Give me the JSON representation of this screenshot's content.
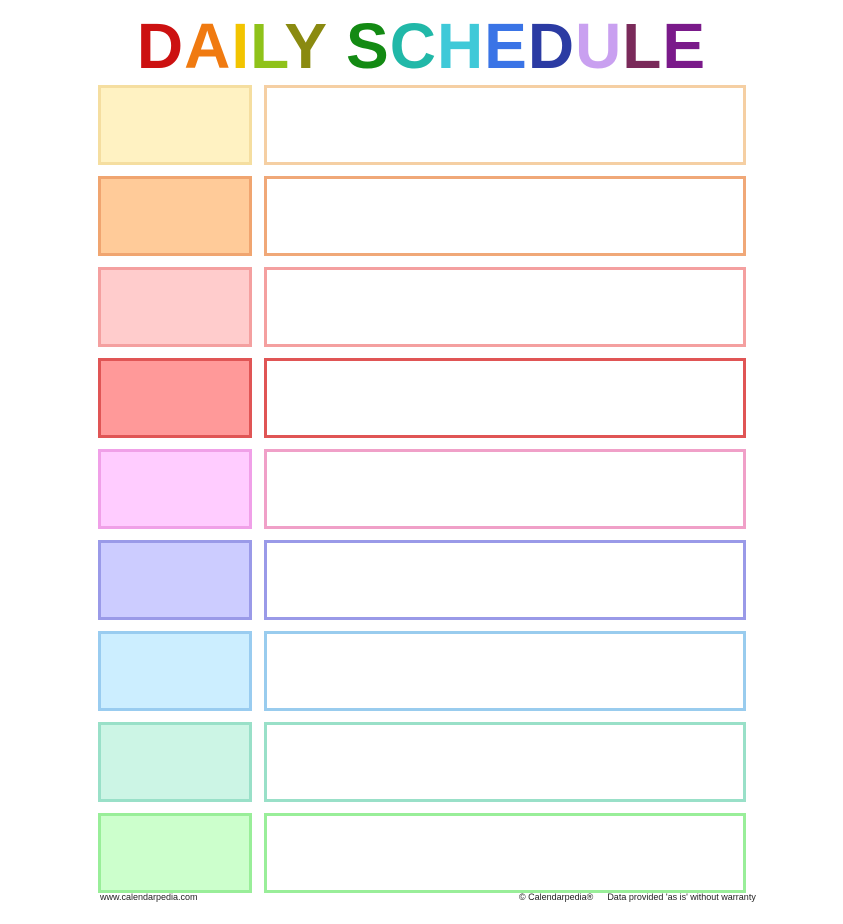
{
  "title": {
    "letters": [
      {
        "char": "D",
        "color": "#cc1111"
      },
      {
        "char": "A",
        "color": "#f07a10"
      },
      {
        "char": "I",
        "color": "#f2c400"
      },
      {
        "char": "L",
        "color": "#8fc21a"
      },
      {
        "char": "Y",
        "color": "#8a8a10"
      },
      {
        "char": " ",
        "color": "#ffffff"
      },
      {
        "char": "S",
        "color": "#138a13"
      },
      {
        "char": "C",
        "color": "#21b8a8"
      },
      {
        "char": "H",
        "color": "#3fc9d8"
      },
      {
        "char": "E",
        "color": "#3a74e6"
      },
      {
        "char": "D",
        "color": "#2b3ba3"
      },
      {
        "char": "U",
        "color": "#c9a0f0"
      },
      {
        "char": "L",
        "color": "#7a2a5a"
      },
      {
        "char": "E",
        "color": "#7a1a8a"
      }
    ]
  },
  "rows": [
    {
      "fill": "#fff2c2",
      "border": "#f5dea0",
      "task_border": "#f5cfa3"
    },
    {
      "fill": "#ffcb99",
      "border": "#f0a570",
      "task_border": "#f0a878"
    },
    {
      "fill": "#ffcccc",
      "border": "#f4a0a0",
      "task_border": "#f4a0a0"
    },
    {
      "fill": "#ff9999",
      "border": "#e05555",
      "task_border": "#e05555"
    },
    {
      "fill": "#ffccff",
      "border": "#f0a0e8",
      "task_border": "#f0a0c8"
    },
    {
      "fill": "#ccccff",
      "border": "#9a9ae8",
      "task_border": "#9a9ae8"
    },
    {
      "fill": "#cceeff",
      "border": "#99ccf0",
      "task_border": "#99ccee"
    },
    {
      "fill": "#ccf5e5",
      "border": "#99e0c8",
      "task_border": "#99e0c8"
    },
    {
      "fill": "#ccffcc",
      "border": "#99ee99",
      "task_border": "#99ee99"
    }
  ],
  "footer": {
    "left": "www.calendarpedia.com",
    "right_copyright": "© Calendarpedia®",
    "right_disclaimer": "Data provided 'as is' without warranty"
  }
}
